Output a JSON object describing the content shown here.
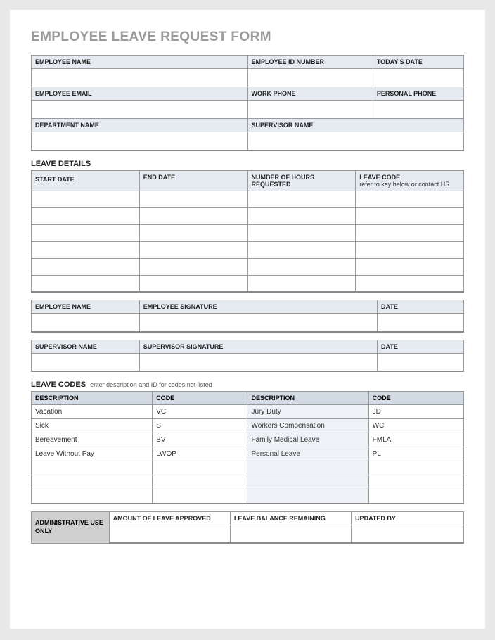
{
  "title": "EMPLOYEE LEAVE REQUEST FORM",
  "info": {
    "row1": {
      "c1": "EMPLOYEE NAME",
      "c2": "EMPLOYEE ID NUMBER",
      "c3": "TODAY'S DATE"
    },
    "row2": {
      "c1": "EMPLOYEE EMAIL",
      "c2": "WORK PHONE",
      "c3": "PERSONAL PHONE"
    },
    "row3": {
      "c1": "DEPARTMENT NAME",
      "c2": "SUPERVISOR NAME"
    }
  },
  "leave_details": {
    "title": "LEAVE DETAILS",
    "headers": {
      "start": "START DATE",
      "end": "END DATE",
      "hours": "NUMBER OF HOURS REQUESTED",
      "code": "LEAVE CODE",
      "code_sub": "refer to key below or contact HR"
    }
  },
  "sig": {
    "emp_name": "EMPLOYEE NAME",
    "emp_sign": "EMPLOYEE SIGNATURE",
    "emp_date": "DATE",
    "sup_name": "SUPERVISOR NAME",
    "sup_sign": "SUPERVISOR SIGNATURE",
    "sup_date": "DATE"
  },
  "codes": {
    "title": "LEAVE CODES",
    "hint": "enter description and ID for codes not listed",
    "headers": {
      "desc": "DESCRIPTION",
      "code": "CODE"
    },
    "rows": [
      {
        "d1": "Vacation",
        "c1": "VC",
        "d2": "Jury Duty",
        "c2": "JD"
      },
      {
        "d1": "Sick",
        "c1": "S",
        "d2": "Workers Compensation",
        "c2": "WC"
      },
      {
        "d1": "Bereavement",
        "c1": "BV",
        "d2": "Family Medical Leave",
        "c2": "FMLA"
      },
      {
        "d1": "Leave Without Pay",
        "c1": "LWOP",
        "d2": "Personal Leave",
        "c2": "PL"
      },
      {
        "d1": "",
        "c1": "",
        "d2": "",
        "c2": ""
      },
      {
        "d1": "",
        "c1": "",
        "d2": "",
        "c2": ""
      },
      {
        "d1": "",
        "c1": "",
        "d2": "",
        "c2": ""
      }
    ]
  },
  "admin": {
    "label": "ADMINISTRATIVE USE ONLY",
    "approved": "AMOUNT OF LEAVE APPROVED",
    "balance": "LEAVE BALANCE REMAINING",
    "updated": "UPDATED BY"
  }
}
